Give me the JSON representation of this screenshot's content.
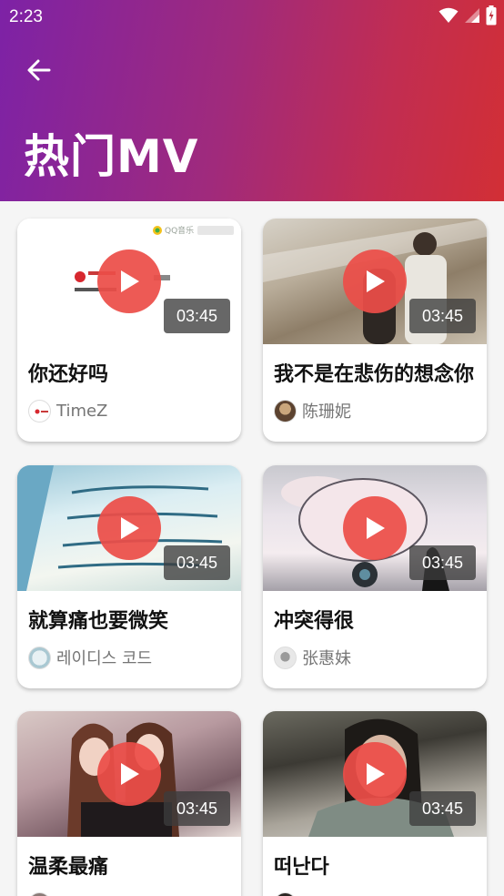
{
  "status": {
    "time": "2:23"
  },
  "header": {
    "title": "热门MV"
  },
  "colors": {
    "gradient_start": "#7d22a6",
    "gradient_end": "#d22f35",
    "play_button": "#ec4e48"
  },
  "icons": {
    "back": "arrow-left-icon",
    "play": "play-icon",
    "wifi": "wifi-icon",
    "signal": "signal-icon",
    "battery": "battery-icon"
  },
  "thumbnail_1": {
    "brand_text": "QQ音乐"
  },
  "mvs": [
    {
      "title": "你还好吗",
      "artist": "TimeZ",
      "duration": "03:45"
    },
    {
      "title": "我不是在悲伤的想念你",
      "artist": "陈珊妮",
      "duration": "03:45"
    },
    {
      "title": "就算痛也要微笑",
      "artist": "레이디스 코드",
      "duration": "03:45"
    },
    {
      "title": "冲突得很",
      "artist": "张惠妹",
      "duration": "03:45"
    },
    {
      "title": "温柔最痛",
      "artist": "",
      "duration": "03:45"
    },
    {
      "title": "떠난다",
      "artist": "",
      "duration": "03:45"
    }
  ]
}
